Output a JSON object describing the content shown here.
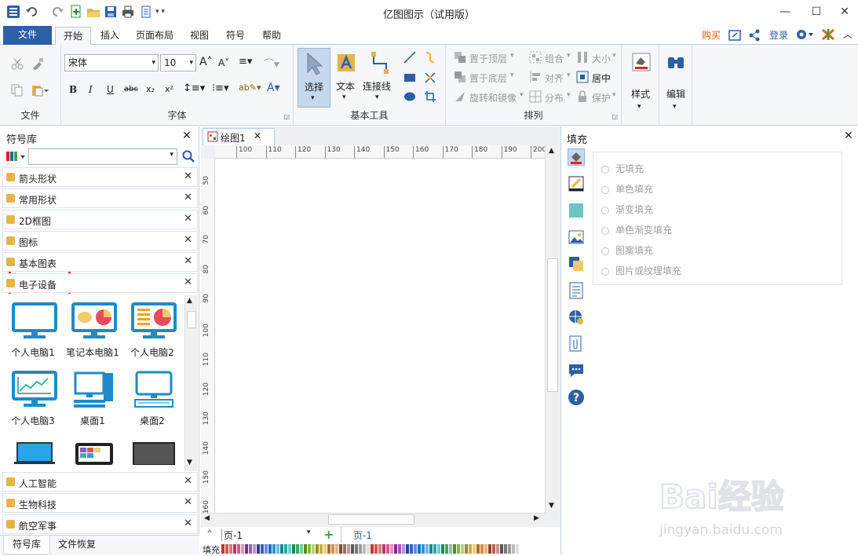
{
  "window": {
    "title": "亿图图示（试用版）",
    "min": "—",
    "max": "☐",
    "close": "✕"
  },
  "tabs": {
    "file": "文件",
    "start": "开始",
    "insert": "插入",
    "layout": "页面布局",
    "view": "视图",
    "symbol": "符号",
    "help": "帮助"
  },
  "header_right": {
    "buy": "购买",
    "login": "登录"
  },
  "ribbon": {
    "file_group": "文件",
    "font_group": "字体",
    "font_name": "宋体",
    "font_size": "10",
    "basic_tools_group": "基本工具",
    "select": "选择",
    "text": "文本",
    "connector": "连接线",
    "arrange_group": "排列",
    "bring_front": "置于顶层",
    "send_back": "置于底层",
    "rotate_mirror": "旋转和镜像",
    "group": "组合",
    "align": "对齐",
    "distribute": "分布",
    "size": "大小",
    "center": "居中",
    "protect": "保护",
    "style": "样式",
    "edit": "编辑"
  },
  "library": {
    "title": "符号库",
    "search_placeholder": "",
    "categories_top": [
      "箭头形状",
      "常用形状",
      "2D框图",
      "图标",
      "基本图表",
      "电子设备"
    ],
    "shapes": [
      {
        "label": "个人电脑1",
        "icon": "monitor-icon"
      },
      {
        "label": "笔记本电脑1",
        "icon": "monitor-chart-icon"
      },
      {
        "label": "个人电脑2",
        "icon": "monitor-pie-icon"
      },
      {
        "label": "个人电脑3",
        "icon": "monitor-line-icon"
      },
      {
        "label": "桌面1",
        "icon": "desktop-tower-icon"
      },
      {
        "label": "桌面2",
        "icon": "desktop-keyboard-icon"
      }
    ],
    "categories_bottom": [
      "人工智能",
      "生物科技",
      "航空军事"
    ],
    "bottom_tabs": [
      "符号库",
      "文件恢复"
    ]
  },
  "document": {
    "tab": "绘图1",
    "hruler": [
      "100",
      "110",
      "120",
      "130",
      "140",
      "150",
      "160",
      "170",
      "180",
      "190",
      "200"
    ],
    "vruler": [
      "50",
      "60",
      "70",
      "80",
      "90",
      "100",
      "110",
      "120",
      "130",
      "140",
      "150",
      "160"
    ],
    "page_select": "页-1",
    "page_tab": "页-1",
    "fill_label": "填充"
  },
  "fill_panel": {
    "title": "填充",
    "options": [
      "无填充",
      "单色填充",
      "渐变填充",
      "单色渐变填充",
      "图案填充",
      "图片或纹理填充"
    ],
    "selected": "无填充"
  },
  "watermark": {
    "brand": "Bai经验",
    "url": "jingyan.baidu.com"
  },
  "colors": {
    "accent": "#2b5fa8",
    "highlight": "#e0201f",
    "buy": "#e8620d"
  }
}
